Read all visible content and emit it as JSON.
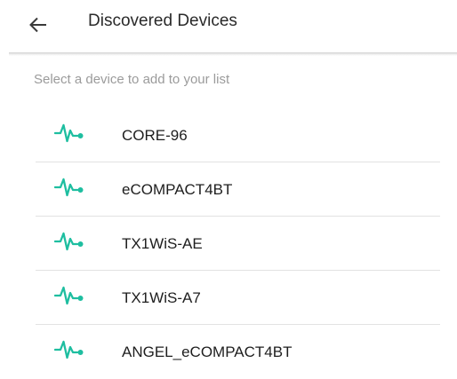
{
  "header": {
    "back_icon": "arrow-left-icon",
    "title": "Discovered Devices"
  },
  "hint": "Select a device to add to your list",
  "devices": {
    "icon": "pulse-waveform-icon",
    "accent_color": "#1ebea0",
    "items": [
      {
        "name": "CORE-96"
      },
      {
        "name": "eCOMPACT4BT"
      },
      {
        "name": "TX1WiS-AE"
      },
      {
        "name": "TX1WiS-A7"
      },
      {
        "name": "ANGEL_eCOMPACT4BT"
      }
    ]
  }
}
